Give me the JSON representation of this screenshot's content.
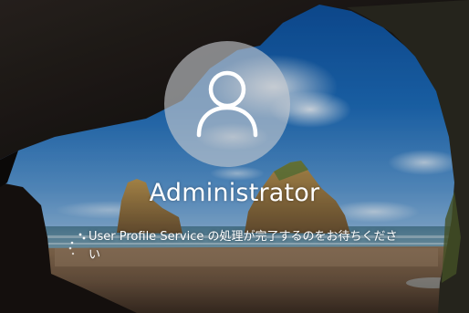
{
  "lock_screen": {
    "user": {
      "name": "Administrator",
      "avatar_icon": "user-silhouette-icon"
    },
    "status": {
      "message": "User Profile Service の処理が完了するのをお待ちください",
      "spinner_icon": "loading-spinner-icon"
    }
  },
  "colors": {
    "text": "#ffffff",
    "avatar_bg": "#c8ccd0"
  }
}
